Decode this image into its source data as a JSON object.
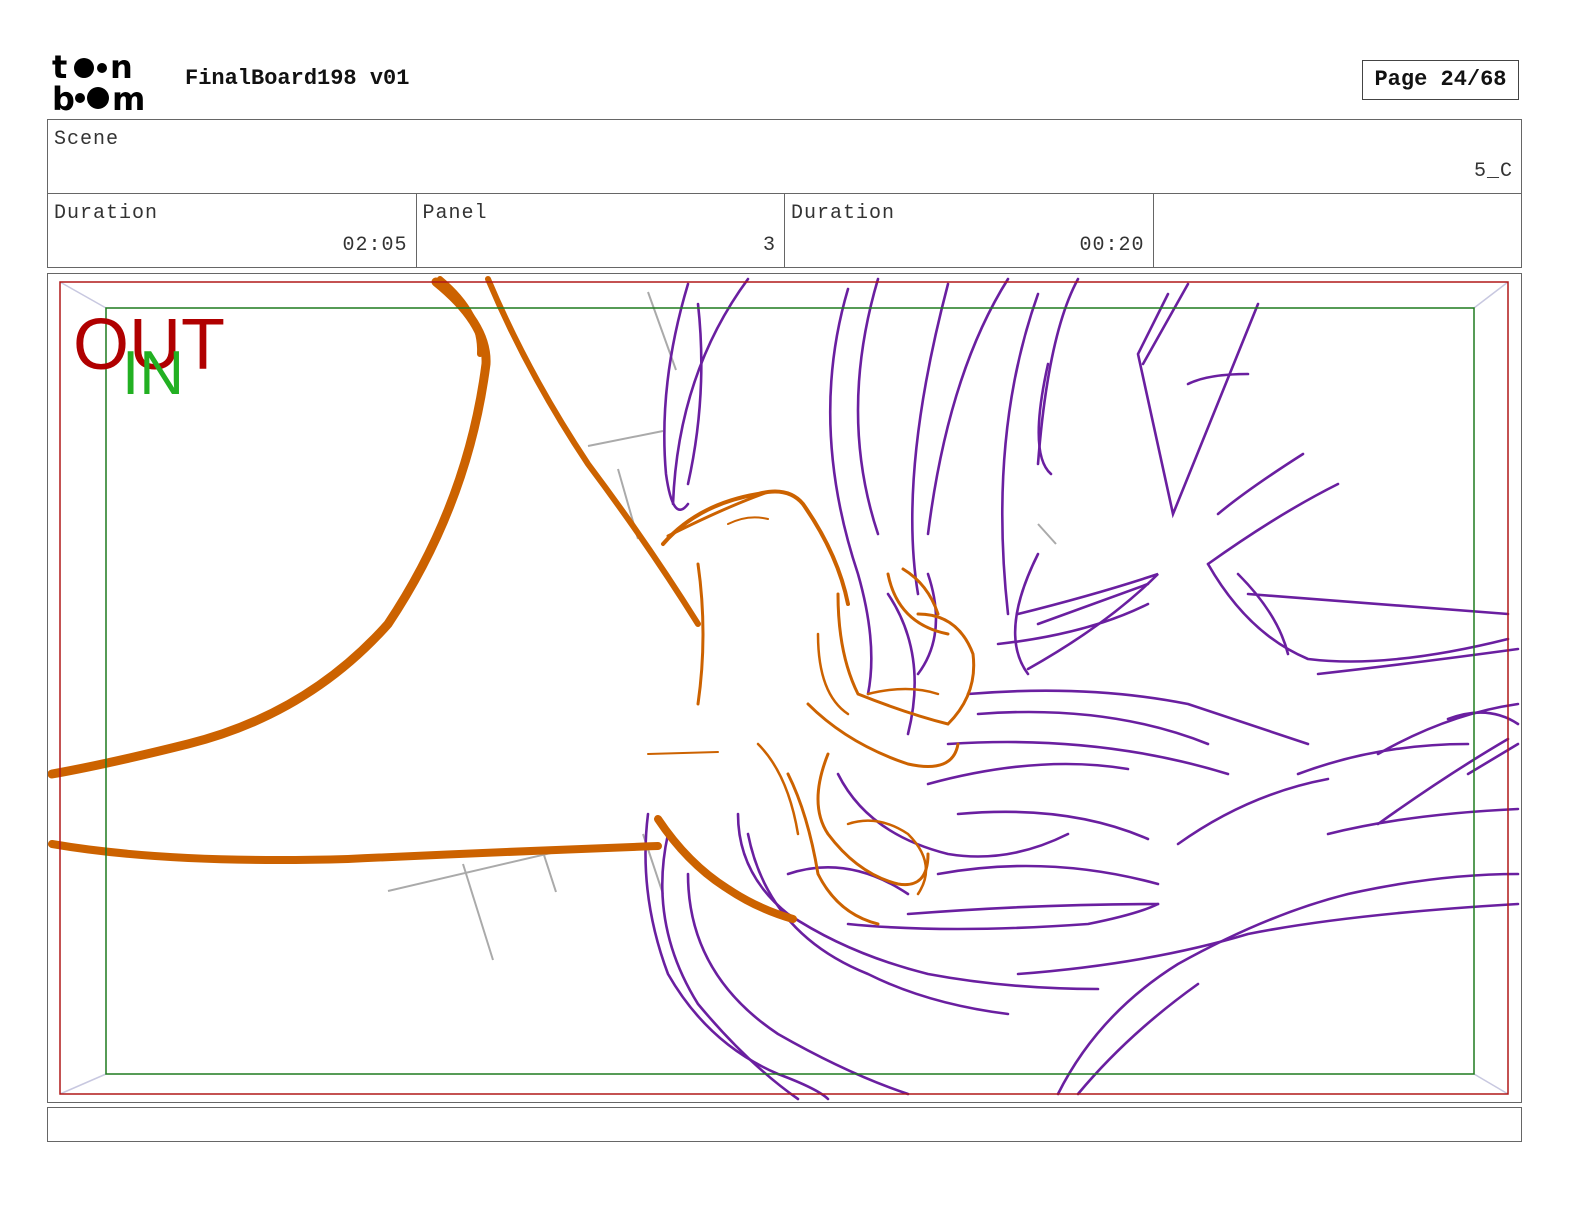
{
  "header": {
    "logo_text": "toonboom",
    "title": "FinalBoard198 v01",
    "page": "Page 24/68"
  },
  "scene": {
    "label": "Scene",
    "value": "5_C"
  },
  "info": [
    {
      "label": "Duration",
      "value": "02:05"
    },
    {
      "label": "Panel",
      "value": "3"
    },
    {
      "label": "Duration",
      "value": "00:20"
    },
    {
      "label": "",
      "value": ""
    }
  ],
  "panel": {
    "safe_labels": {
      "out": "OUT",
      "in": "IN"
    },
    "colors": {
      "out_frame": "#b01818",
      "in_frame": "#1f7a1f",
      "out_text": "#b00000",
      "in_text": "#22b022",
      "orange_stroke": "#cc6200",
      "purple_stroke": "#6a1fa0",
      "guide_lines": "#aaaaaa"
    }
  },
  "notes": {
    "text": ""
  }
}
